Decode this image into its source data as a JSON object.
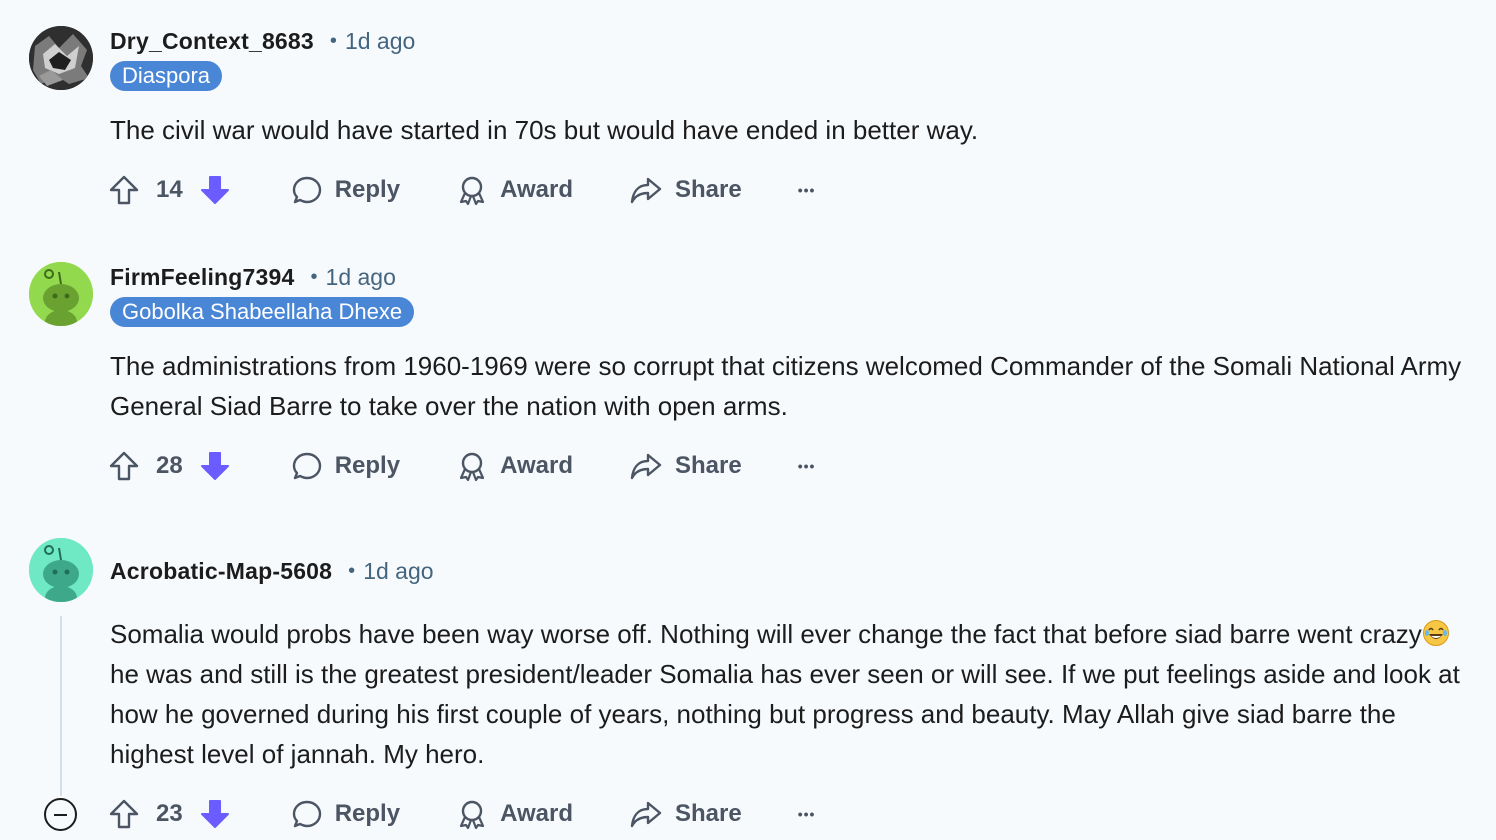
{
  "comments": [
    {
      "username": "Dry_Context_8683",
      "separator": "•",
      "time": "1d ago",
      "flair": "Diaspora",
      "body": "The civil war would have started in 70s but would have ended in better way.",
      "votes": "14",
      "reply_label": "Reply",
      "award_label": "Award",
      "share_label": "Share",
      "more_label": "•••"
    },
    {
      "username": "FirmFeeling7394",
      "separator": "•",
      "time": "1d ago",
      "flair": "Gobolka Shabeellaha Dhexe",
      "body": "The administrations from 1960-1969 were so corrupt that citizens welcomed Commander of the Somali National Army General Siad Barre to take over the nation with open arms.",
      "votes": "28",
      "reply_label": "Reply",
      "award_label": "Award",
      "share_label": "Share",
      "more_label": "•••"
    },
    {
      "username": "Acrobatic-Map-5608",
      "separator": "•",
      "time": "1d ago",
      "body_part1": "Somalia would probs have been way worse off. Nothing will ever change the fact that before siad barre went crazy",
      "body_part2": " he was and still is the greatest president/leader Somalia has ever seen or will see. If we put feelings aside and look at how he governed during his first couple of years, nothing but progress and beauty. May Allah give siad barre the highest level of jannah. My hero.",
      "votes": "23",
      "reply_label": "Reply",
      "award_label": "Award",
      "share_label": "Share",
      "more_label": "•••"
    }
  ],
  "colors": {
    "downvote": "#6a5cff",
    "flair_bg": "#4a86d6",
    "meta_text": "#44657f"
  },
  "icons": [
    "upvote-icon",
    "downvote-icon",
    "reply-icon",
    "award-icon",
    "share-icon",
    "more-icon",
    "collapse-icon",
    "laughing-emoji"
  ]
}
